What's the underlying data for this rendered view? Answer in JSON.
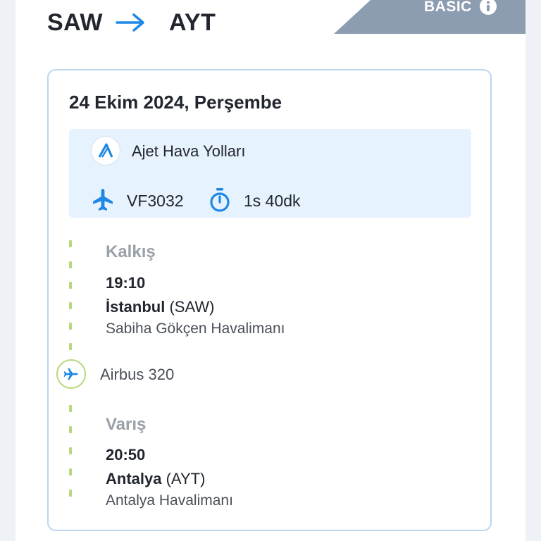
{
  "route": {
    "origin": "SAW",
    "destination": "AYT"
  },
  "fare": {
    "label": "BASIC"
  },
  "flight": {
    "date": "24 Ekim 2024, Perşembe",
    "airline": "Ajet Hava Yolları",
    "flight_number": "VF3032",
    "duration": "1s 40dk",
    "aircraft": "Airbus 320"
  },
  "departure": {
    "label": "Kalkış",
    "time": "19:10",
    "city": "İstanbul",
    "code": "(SAW)",
    "airport": "Sabiha Gökçen Havalimanı"
  },
  "arrival": {
    "label": "Varış",
    "time": "20:50",
    "city": "Antalya",
    "code": "(AYT)",
    "airport": "Antalya Havalimanı"
  },
  "colors": {
    "accent": "#1e88e5",
    "timeline": "#b6d97e",
    "fare_ribbon": "#8c9cb1",
    "airline_bg": "#e6f2fd"
  },
  "icons": {
    "route_arrow": "arrow-right-icon",
    "fare_info": "info-icon",
    "airline_logo": "ajet-logo",
    "flight": "airplane-icon",
    "duration": "stopwatch-icon",
    "aircraft": "airplane-icon"
  }
}
